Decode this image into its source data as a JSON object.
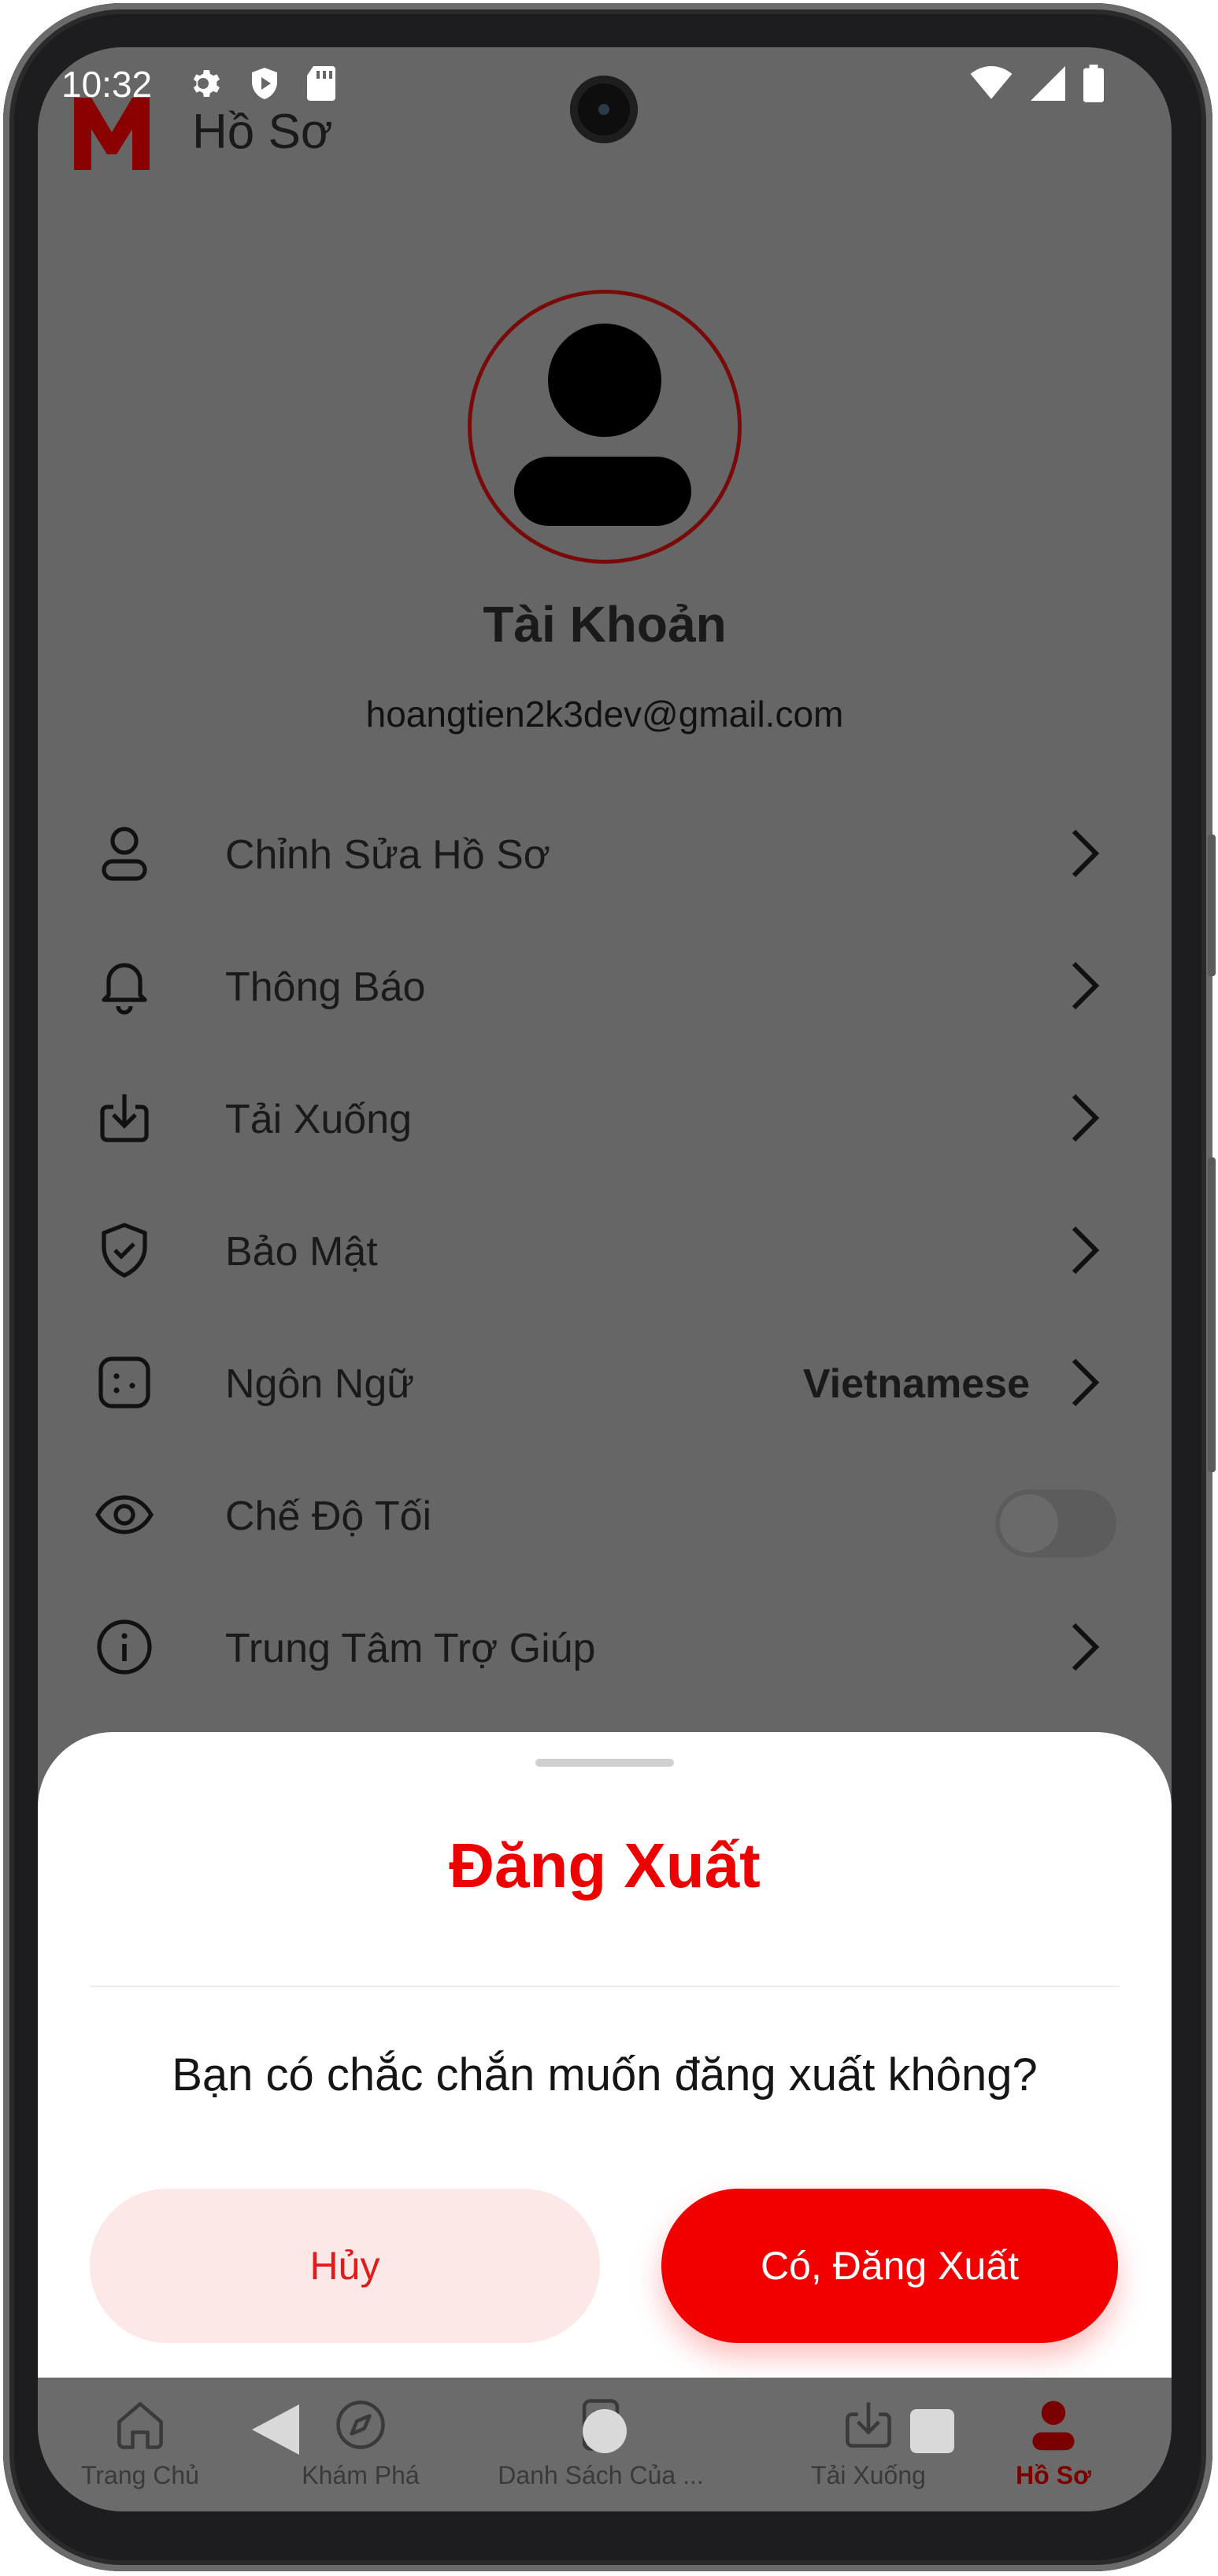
{
  "status_bar": {
    "time": "10:32",
    "left_icons": [
      "settings-icon",
      "shield-play-icon",
      "sd-card-icon"
    ],
    "right_icons": [
      "wifi-icon",
      "cell-signal-icon",
      "battery-icon"
    ]
  },
  "header": {
    "logo_icon": "m-logo-icon",
    "title": "Hồ Sơ"
  },
  "profile": {
    "avatar_icon": "user-avatar-icon",
    "name": "Tài Khoản",
    "email": "hoangtien2k3dev@gmail.com"
  },
  "menu": {
    "items": [
      {
        "label": "Chỉnh Sửa Hồ Sơ",
        "icon": "user-icon",
        "trailing": "chevron"
      },
      {
        "label": "Thông Báo",
        "icon": "bell-icon",
        "trailing": "chevron"
      },
      {
        "label": "Tải Xuống",
        "icon": "download-icon",
        "trailing": "chevron"
      },
      {
        "label": "Bảo Mật",
        "icon": "shield-check-icon",
        "trailing": "chevron"
      },
      {
        "label": "Ngôn Ngữ",
        "icon": "dots-square-icon",
        "trailing": "chevron",
        "value": "Vietnamese"
      },
      {
        "label": "Chế Độ Tối",
        "icon": "eye-icon",
        "trailing": "toggle",
        "toggle_on": false
      },
      {
        "label": "Trung Tâm Trợ Giúp",
        "icon": "info-icon",
        "trailing": "chevron"
      }
    ]
  },
  "logout_sheet": {
    "title": "Đăng Xuất",
    "message": "Bạn có chắc chắn muốn đăng xuất không?",
    "cancel_label": "Hủy",
    "confirm_label": "Có, Đăng Xuất"
  },
  "bottom_nav": {
    "items": [
      {
        "label": "Trang Chủ",
        "icon": "home-icon",
        "active": false
      },
      {
        "label": "Khám Phá",
        "icon": "compass-icon",
        "active": false
      },
      {
        "label": "Danh Sách Của ...",
        "icon": "bookmark-list-icon",
        "active": false
      },
      {
        "label": "Tải Xuống",
        "icon": "download-icon",
        "active": false
      },
      {
        "label": "Hồ Sơ",
        "icon": "profile-icon",
        "active": true
      }
    ]
  },
  "colors": {
    "overlay_bg": "#666666",
    "accent_red": "#f20000",
    "title_red": "#ec0000",
    "cancel_bg": "#fde8e8",
    "logo_red": "#8b0000"
  }
}
